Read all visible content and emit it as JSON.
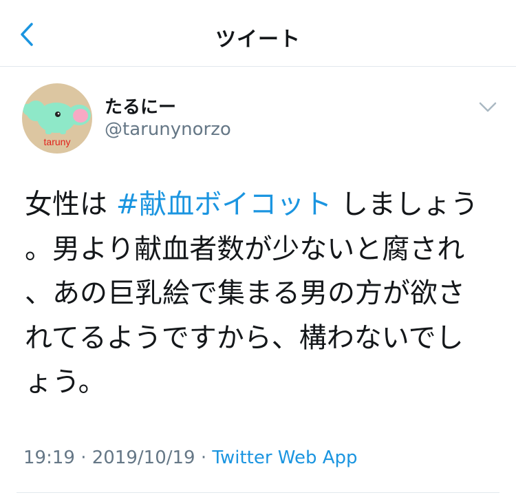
{
  "nav": {
    "title": "ツイート",
    "back_icon": "chevron-left-icon"
  },
  "colors": {
    "link": "#1b95e0",
    "text": "#14171a",
    "secondary": "#657786",
    "divider": "#e1e8ed",
    "avatar_bg": "#dcc6a1",
    "elephant": "#8ee8c8",
    "elephant_ear": "#f7a9c4",
    "avatar_label": "#e0221b"
  },
  "user": {
    "display_name": "たるにー",
    "handle": "@tarunynorzo",
    "avatar_label": "taruny",
    "avatar_icon": "elephant-avatar-icon",
    "menu_icon": "chevron-down-icon"
  },
  "tweet": {
    "text_before": "女性は ",
    "hashtag": "#献血ボイコット",
    "text_after": " しましょう。男より献血者数が少ないと腐され、あの巨乳絵で集まる男の方が欲されてるようですから、構わないでしょう。"
  },
  "meta": {
    "time": "19:19",
    "separator_1": " · ",
    "date": "2019/10/19",
    "separator_2": " · ",
    "source": "Twitter Web App"
  }
}
